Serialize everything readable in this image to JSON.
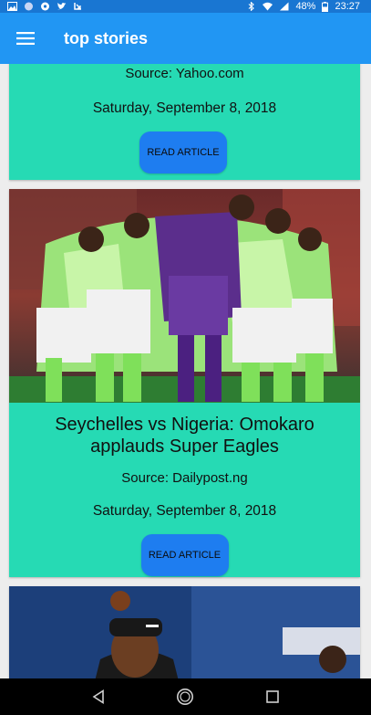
{
  "status_bar": {
    "icons_left": [
      "image-icon",
      "circle-icon",
      "soccer-ball-icon",
      "twitter-icon",
      "download-icon"
    ],
    "icons_right": [
      "bluetooth-icon",
      "wifi-icon",
      "signal-icon"
    ],
    "battery": "48%",
    "time": "23:27"
  },
  "app_bar": {
    "title": "top stories",
    "menu_icon": "hamburger-menu-icon"
  },
  "articles": [
    {
      "source": "Source: Yahoo.com",
      "date": "Saturday, September 8, 2018",
      "button_label": "READ ARTICLE"
    },
    {
      "headline": "Seychelles vs Nigeria: Omokaro applauds Super Eagles",
      "source": "Source: Dailypost.ng",
      "date": "Saturday, September 8, 2018",
      "button_label": "READ ARTICLE",
      "image_icon": "football-team-huddle-photo"
    },
    {
      "image_icon": "tennis-player-photo"
    }
  ],
  "nav_bar": {
    "back_icon": "back-icon",
    "home_icon": "home-icon",
    "recents_icon": "recents-icon"
  },
  "colors": {
    "status_bar": "#1976d2",
    "app_bar": "#2196f3",
    "card": "#26dab4",
    "button": "#1e7df0",
    "background": "#ededed"
  }
}
